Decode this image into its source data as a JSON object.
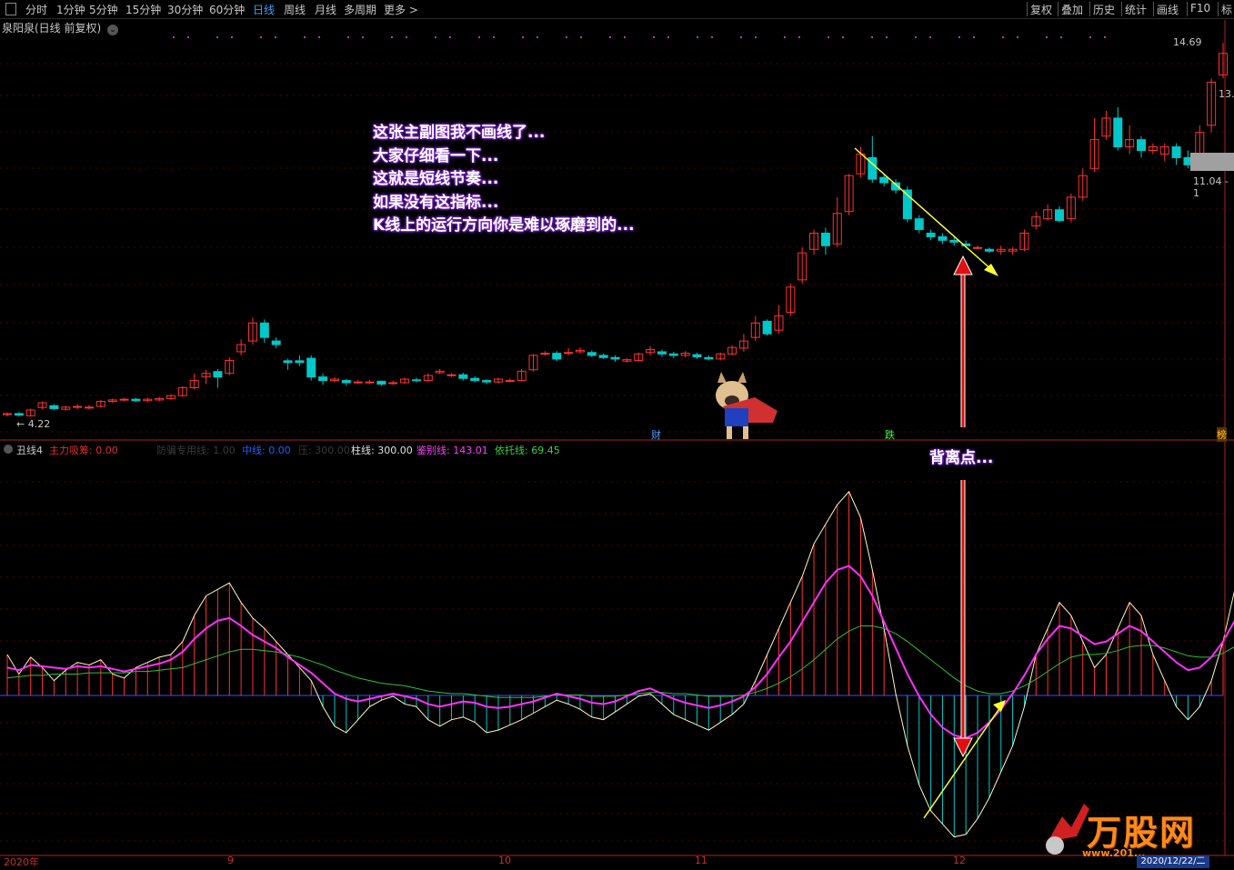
{
  "toolbar": {
    "periods": [
      "分时",
      "1分钟",
      "5分钟",
      "15分钟",
      "30分钟",
      "60分钟",
      "日线",
      "周线",
      "月线",
      "多周期",
      "更多 >"
    ],
    "active_period": "日线",
    "right_buttons": [
      "复权",
      "叠加",
      "历史",
      "统计",
      "画线",
      "F10",
      "标"
    ]
  },
  "stock": {
    "title": "泉阳泉(日线 前复权)"
  },
  "price_labels": {
    "high": "14.69",
    "last": "13.",
    "gray_box": "11.04 - 1",
    "low_marker": "← 4.22"
  },
  "annotation": {
    "lines": [
      "这张主副图我不画线了...",
      "大家仔细看一下...",
      "这就是短线节奏...",
      "如果没有这指标...",
      "K线上的运行方向你是难以琢磨到的..."
    ],
    "divergence": "背离点..."
  },
  "event_tags": {
    "cai": "财",
    "die": "跌",
    "bang": "榜"
  },
  "sub_indicator": {
    "name": "丑线4",
    "items": [
      {
        "label": "主力吸筹:",
        "value": "0.00",
        "color": "#e03030"
      },
      {
        "label": "防骗专用线:",
        "value": "1.00",
        "color": "#3a3a3a"
      },
      {
        "label": "中线:",
        "value": "0.00",
        "color": "#2060ff"
      },
      {
        "label": "压:",
        "value": "300.00",
        "color": "#3a3a3a"
      },
      {
        "label": "柱线:",
        "value": "300.00",
        "color": "#e0e0e0"
      },
      {
        "label": "鉴别线:",
        "value": "143.01",
        "color": "#ff40ff"
      },
      {
        "label": "依托线:",
        "value": "69.45",
        "color": "#40d040"
      }
    ]
  },
  "x_axis": [
    "2020年",
    "9",
    "10",
    "11",
    "12"
  ],
  "watermark": {
    "brand": "万股网",
    "url": "www.201..."
  },
  "date_box": "2020/12/22/二",
  "colors": {
    "up": "#ff3232",
    "down": "#00c8c8",
    "bg": "#000000",
    "grid": "#8b0000"
  },
  "chart_data": {
    "type": "candlestick",
    "price_range": [
      4.22,
      14.69
    ],
    "candles": [
      [
        4.35,
        4.38,
        4.3,
        4.41
      ],
      [
        4.38,
        4.34,
        4.3,
        4.42
      ],
      [
        4.32,
        4.48,
        4.3,
        4.52
      ],
      [
        4.55,
        4.68,
        4.5,
        4.72
      ],
      [
        4.6,
        4.52,
        4.48,
        4.64
      ],
      [
        4.5,
        4.56,
        4.46,
        4.6
      ],
      [
        4.56,
        4.58,
        4.5,
        4.64
      ],
      [
        4.55,
        4.56,
        4.5,
        4.62
      ],
      [
        4.58,
        4.72,
        4.55,
        4.76
      ],
      [
        4.72,
        4.76,
        4.68,
        4.8
      ],
      [
        4.76,
        4.78,
        4.72,
        4.82
      ],
      [
        4.78,
        4.74,
        4.7,
        4.82
      ],
      [
        4.74,
        4.78,
        4.7,
        4.82
      ],
      [
        4.76,
        4.8,
        4.72,
        4.84
      ],
      [
        4.8,
        4.88,
        4.76,
        4.92
      ],
      [
        4.88,
        5.1,
        4.85,
        5.14
      ],
      [
        5.1,
        5.3,
        5.05,
        5.5
      ],
      [
        5.4,
        5.5,
        5.2,
        5.6
      ],
      [
        5.55,
        5.4,
        5.1,
        5.62
      ],
      [
        5.5,
        5.86,
        5.45,
        5.95
      ],
      [
        6.1,
        6.3,
        6.0,
        6.45
      ],
      [
        6.4,
        6.9,
        6.3,
        7.05
      ],
      [
        6.9,
        6.5,
        6.35,
        7.0
      ],
      [
        6.4,
        6.3,
        6.2,
        6.5
      ],
      [
        5.85,
        5.8,
        5.6,
        5.9
      ],
      [
        5.85,
        5.8,
        5.7,
        6.0
      ],
      [
        5.92,
        5.4,
        5.3,
        6.0
      ],
      [
        5.4,
        5.3,
        5.18,
        5.5
      ],
      [
        5.3,
        5.34,
        5.25,
        5.4
      ],
      [
        5.3,
        5.24,
        5.15,
        5.35
      ],
      [
        5.26,
        5.26,
        5.2,
        5.32
      ],
      [
        5.26,
        5.26,
        5.2,
        5.32
      ],
      [
        5.28,
        5.2,
        5.15,
        5.3
      ],
      [
        5.22,
        5.24,
        5.18,
        5.3
      ],
      [
        5.24,
        5.34,
        5.2,
        5.38
      ],
      [
        5.32,
        5.3,
        5.25,
        5.38
      ],
      [
        5.3,
        5.44,
        5.25,
        5.5
      ],
      [
        5.52,
        5.56,
        5.48,
        5.62
      ],
      [
        5.46,
        5.46,
        5.4,
        5.5
      ],
      [
        5.46,
        5.36,
        5.3,
        5.52
      ],
      [
        5.36,
        5.3,
        5.25,
        5.42
      ],
      [
        5.3,
        5.26,
        5.2,
        5.34
      ],
      [
        5.26,
        5.34,
        5.22,
        5.38
      ],
      [
        5.3,
        5.3,
        5.25,
        5.36
      ],
      [
        5.3,
        5.56,
        5.28,
        5.62
      ],
      [
        5.6,
        6.0,
        5.55,
        6.04
      ],
      [
        6.04,
        6.06,
        5.98,
        6.12
      ],
      [
        6.06,
        5.9,
        5.84,
        6.12
      ],
      [
        6.06,
        6.08,
        6.0,
        6.2
      ],
      [
        6.1,
        6.14,
        6.05,
        6.22
      ],
      [
        6.08,
        6.0,
        5.95,
        6.14
      ],
      [
        6.0,
        5.94,
        5.9,
        6.05
      ],
      [
        5.94,
        5.9,
        5.82,
        6.0
      ],
      [
        5.84,
        5.88,
        5.8,
        5.92
      ],
      [
        5.86,
        6.04,
        5.82,
        6.08
      ],
      [
        6.08,
        6.16,
        6.0,
        6.26
      ],
      [
        6.1,
        6.04,
        5.96,
        6.16
      ],
      [
        6.04,
        6.0,
        5.92,
        6.1
      ],
      [
        6.0,
        6.06,
        5.94,
        6.12
      ],
      [
        6.02,
        5.96,
        5.9,
        6.08
      ],
      [
        5.94,
        5.9,
        5.86,
        6.0
      ],
      [
        5.9,
        6.04,
        5.86,
        6.08
      ],
      [
        6.04,
        6.22,
        6.0,
        6.28
      ],
      [
        6.2,
        6.4,
        6.1,
        6.6
      ],
      [
        6.5,
        6.9,
        6.4,
        7.1
      ],
      [
        6.95,
        6.6,
        6.55,
        7.0
      ],
      [
        6.7,
        7.1,
        6.6,
        7.4
      ],
      [
        7.2,
        7.9,
        7.1,
        8.0
      ],
      [
        8.1,
        8.85,
        8.0,
        9.0
      ],
      [
        8.95,
        9.4,
        8.8,
        9.5
      ],
      [
        9.4,
        9.05,
        8.8,
        9.55
      ],
      [
        9.1,
        9.95,
        9.0,
        10.4
      ],
      [
        10.0,
        11.0,
        9.9,
        11.05
      ],
      [
        11.05,
        11.6,
        10.95,
        11.8
      ],
      [
        11.5,
        10.9,
        10.8,
        12.1
      ],
      [
        10.95,
        10.8,
        10.7,
        11.05
      ],
      [
        10.8,
        10.6,
        10.5,
        10.9
      ],
      [
        10.6,
        9.8,
        9.7,
        10.7
      ],
      [
        9.8,
        9.5,
        9.4,
        9.9
      ],
      [
        9.4,
        9.3,
        9.2,
        9.5
      ],
      [
        9.3,
        9.2,
        9.1,
        9.4
      ],
      [
        9.2,
        9.15,
        9.05,
        9.3
      ],
      [
        9.1,
        9.05,
        9.0,
        9.2
      ],
      [
        9.0,
        9.0,
        8.95,
        9.06
      ],
      [
        8.95,
        8.9,
        8.85,
        9.0
      ],
      [
        8.9,
        8.95,
        8.8,
        9.05
      ],
      [
        8.9,
        8.95,
        8.8,
        9.0
      ],
      [
        8.95,
        9.4,
        8.9,
        9.5
      ],
      [
        9.6,
        9.85,
        9.5,
        10.0
      ],
      [
        9.8,
        10.05,
        9.75,
        10.2
      ],
      [
        10.05,
        9.75,
        9.7,
        10.15
      ],
      [
        9.8,
        10.4,
        9.7,
        10.5
      ],
      [
        10.4,
        11.0,
        10.3,
        11.2
      ],
      [
        11.2,
        12.0,
        11.1,
        12.6
      ],
      [
        12.1,
        12.6,
        12.0,
        12.8
      ],
      [
        12.6,
        11.8,
        11.7,
        12.9
      ],
      [
        11.8,
        12.0,
        11.6,
        12.4
      ],
      [
        12.0,
        11.7,
        11.5,
        12.1
      ],
      [
        11.7,
        11.8,
        11.6,
        11.9
      ],
      [
        11.6,
        11.8,
        11.4,
        11.9
      ],
      [
        11.8,
        11.5,
        11.3,
        11.9
      ],
      [
        11.5,
        11.3,
        11.2,
        11.7
      ],
      [
        11.5,
        12.2,
        11.4,
        12.4
      ],
      [
        12.4,
        13.6,
        12.2,
        13.7
      ],
      [
        13.8,
        14.4,
        13.7,
        14.69
      ]
    ],
    "indicator_lines": {
      "column_line": [
        150,
        135,
        148,
        140,
        130,
        138,
        144,
        142,
        146,
        135,
        132,
        140,
        144,
        148,
        150,
        160,
        180,
        195,
        200,
        205,
        190,
        178,
        170,
        160,
        150,
        140,
        130,
        110,
        95,
        90,
        100,
        110,
        115,
        118,
        112,
        110,
        100,
        95,
        100,
        102,
        98,
        90,
        92,
        96,
        100,
        105,
        110,
        115,
        112,
        108,
        102,
        100,
        106,
        112,
        118,
        120,
        112,
        104,
        100,
        96,
        92,
        98,
        104,
        112,
        130,
        150,
        170,
        190,
        210,
        235,
        250,
        265,
        275,
        255,
        215,
        170,
        120,
        80,
        50,
        30,
        20,
        10,
        12,
        24,
        40,
        60,
        80,
        110,
        150,
        170,
        190,
        180,
        160,
        140,
        150,
        170,
        190,
        180,
        150,
        130,
        110,
        100,
        110,
        130,
        160,
        200,
        240
      ],
      "appraise_line": [
        140,
        138,
        142,
        141,
        140,
        139,
        141,
        140,
        141,
        139,
        137,
        139,
        141,
        143,
        146,
        152,
        162,
        170,
        176,
        178,
        172,
        165,
        160,
        155,
        148,
        142,
        136,
        128,
        120,
        116,
        114,
        116,
        118,
        120,
        118,
        116,
        112,
        110,
        112,
        114,
        113,
        110,
        109,
        110,
        112,
        114,
        117,
        120,
        118,
        116,
        113,
        112,
        114,
        118,
        122,
        124,
        120,
        116,
        113,
        111,
        109,
        111,
        114,
        118,
        125,
        135,
        148,
        160,
        175,
        190,
        205,
        215,
        218,
        210,
        195,
        175,
        155,
        135,
        118,
        104,
        94,
        88,
        86,
        90,
        98,
        108,
        120,
        134,
        150,
        162,
        172,
        170,
        164,
        158,
        160,
        166,
        172,
        168,
        160,
        152,
        144,
        138,
        140,
        148,
        160,
        176,
        192
      ],
      "support_line": [
        132,
        133,
        134,
        134,
        135,
        135,
        135,
        136,
        136,
        136,
        136,
        137,
        137,
        138,
        139,
        140,
        143,
        146,
        149,
        152,
        154,
        154,
        153,
        152,
        150,
        148,
        145,
        142,
        138,
        135,
        132,
        130,
        128,
        127,
        126,
        124,
        122,
        121,
        120,
        120,
        119,
        118,
        117,
        117,
        117,
        117,
        118,
        119,
        119,
        119,
        118,
        118,
        118,
        119,
        120,
        121,
        121,
        120,
        120,
        119,
        118,
        118,
        118,
        119,
        121,
        124,
        128,
        133,
        139,
        146,
        154,
        162,
        168,
        172,
        172,
        170,
        166,
        160,
        153,
        146,
        139,
        132,
        126,
        122,
        120,
        120,
        122,
        126,
        131,
        137,
        143,
        148,
        150,
        150,
        151,
        153,
        156,
        157,
        157,
        155,
        152,
        149,
        148,
        148,
        151,
        156,
        163
      ]
    }
  }
}
